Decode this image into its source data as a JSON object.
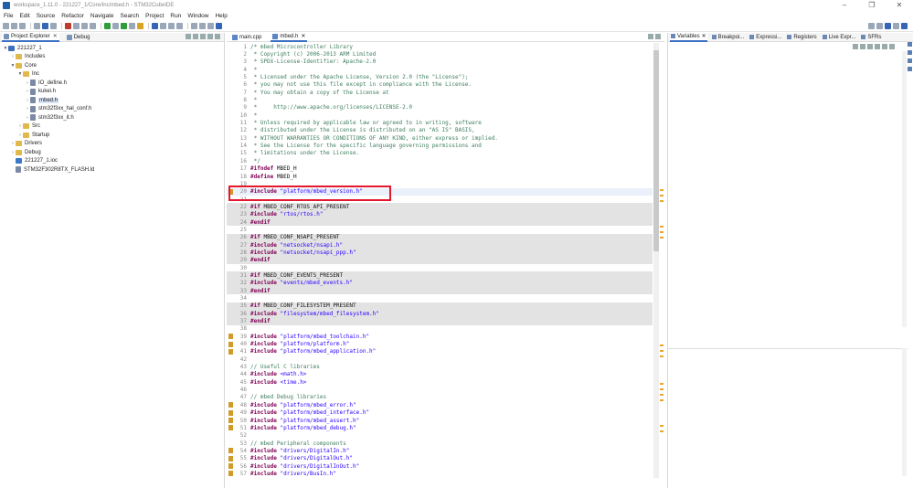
{
  "window": {
    "title": "workspace_1.11.0 - 221227_1/Core/Inc/mbed.h - STM32CubeIDE",
    "controls": [
      "–",
      "❐",
      "✕"
    ]
  },
  "menu": [
    "File",
    "Edit",
    "Source",
    "Refactor",
    "Navigate",
    "Search",
    "Project",
    "Run",
    "Window",
    "Help"
  ],
  "left_panel": {
    "tabs": [
      {
        "label": "Project Explorer",
        "close": "✕"
      },
      {
        "label": "Debug"
      }
    ],
    "tree": [
      {
        "arrow": "▼",
        "label": "221227_1",
        "icon": "proj"
      },
      {
        "arrow": "›",
        "label": "Includes",
        "icon": "fold"
      },
      {
        "arrow": "▼",
        "label": "Core",
        "icon": "fold"
      },
      {
        "arrow": "▼",
        "label": "Inc",
        "icon": "fold"
      },
      {
        "arrow": "›",
        "label": "IO_define.h",
        "icon": "file"
      },
      {
        "arrow": "›",
        "label": "kukei.h",
        "icon": "file"
      },
      {
        "arrow": "›",
        "label": "mbed.h",
        "icon": "file"
      },
      {
        "arrow": "›",
        "label": "stm32f3xx_hal_conf.h",
        "icon": "file"
      },
      {
        "arrow": "›",
        "label": "stm32f3xx_it.h",
        "icon": "file"
      },
      {
        "arrow": "›",
        "label": "Src",
        "icon": "fold"
      },
      {
        "arrow": "›",
        "label": "Startup",
        "icon": "fold"
      },
      {
        "arrow": "›",
        "label": "Drivers",
        "icon": "fold"
      },
      {
        "arrow": "›",
        "label": "Debug",
        "icon": "fold"
      },
      {
        "arrow": "",
        "label": "221227_1.ioc",
        "icon": "ioc"
      },
      {
        "arrow": "",
        "label": "STM32F302R8TX_FLASH.ld",
        "icon": "file"
      }
    ]
  },
  "editor": {
    "tabs": [
      {
        "label": "main.cpp"
      },
      {
        "label": "mbed.h",
        "close": "✕"
      }
    ],
    "lines": [
      {
        "n": "1",
        "t": "/* mbed Microcontroller Library",
        "k": "cm"
      },
      {
        "n": "2",
        "t": " * Copyright (c) 2006-2013 ARM Limited",
        "k": "cm"
      },
      {
        "n": "3",
        "t": " * SPDX-License-Identifier: Apache-2.0",
        "k": "cm"
      },
      {
        "n": "4",
        "t": " *",
        "k": "cm"
      },
      {
        "n": "5",
        "t": " * Licensed under the Apache License, Version 2.0 (the \"License\");",
        "k": "cm"
      },
      {
        "n": "6",
        "t": " * you may not use this file except in compliance with the License.",
        "k": "cm"
      },
      {
        "n": "7",
        "t": " * You may obtain a copy of the License at",
        "k": "cm"
      },
      {
        "n": "8",
        "t": " *",
        "k": "cm"
      },
      {
        "n": "9",
        "t": " *     http://www.apache.org/licenses/LICENSE-2.0",
        "k": "cm"
      },
      {
        "n": "10",
        "t": " *",
        "k": "cm"
      },
      {
        "n": "11",
        "t": " * Unless required by applicable law or agreed to in writing, software",
        "k": "cm"
      },
      {
        "n": "12",
        "t": " * distributed under the License is distributed on an \"AS IS\" BASIS,",
        "k": "cm"
      },
      {
        "n": "13",
        "t": " * WITHOUT WARRANTIES OR CONDITIONS OF ANY KIND, either express or implied.",
        "k": "cm"
      },
      {
        "n": "14",
        "t": " * See the License for the specific language governing permissions and",
        "k": "cm"
      },
      {
        "n": "15",
        "t": " * limitations under the License.",
        "k": "cm"
      },
      {
        "n": "16",
        "t": " */",
        "k": "cm"
      },
      {
        "n": "17",
        "kw": "#ifndef",
        "t": " MBED_H",
        "k": "pp"
      },
      {
        "n": "18",
        "kw": "#define",
        "t": " MBED_H",
        "k": "pp"
      },
      {
        "n": "19",
        "t": "",
        "k": "pl"
      },
      {
        "n": "20",
        "kw": "#include",
        "t": " \"platform/mbed_version.h\"",
        "k": "inc",
        "cur": true,
        "mark": true
      },
      {
        "n": "21",
        "t": "",
        "k": "pl"
      },
      {
        "n": "22",
        "kw": "#if",
        "t": " MBED_CONF_RTOS_API_PRESENT",
        "k": "pp",
        "shade": true
      },
      {
        "n": "23",
        "kw": "#include",
        "t": " \"rtos/rtos.h\"",
        "k": "inc",
        "shade": true
      },
      {
        "n": "24",
        "kw": "#endif",
        "t": "",
        "k": "pp",
        "shade": true
      },
      {
        "n": "25",
        "t": "",
        "k": "pl"
      },
      {
        "n": "26",
        "kw": "#if",
        "t": " MBED_CONF_NSAPI_PRESENT",
        "k": "pp",
        "shade": true
      },
      {
        "n": "27",
        "kw": "#include",
        "t": " \"netsocket/nsapi.h\"",
        "k": "inc",
        "shade": true
      },
      {
        "n": "28",
        "kw": "#include",
        "t": " \"netsocket/nsapi_ppp.h\"",
        "k": "inc",
        "shade": true
      },
      {
        "n": "29",
        "kw": "#endif",
        "t": "",
        "k": "pp",
        "shade": true
      },
      {
        "n": "30",
        "t": "",
        "k": "pl"
      },
      {
        "n": "31",
        "kw": "#if",
        "t": " MBED_CONF_EVENTS_PRESENT",
        "k": "pp",
        "shade": true
      },
      {
        "n": "32",
        "kw": "#include",
        "t": " \"events/mbed_events.h\"",
        "k": "inc",
        "shade": true
      },
      {
        "n": "33",
        "kw": "#endif",
        "t": "",
        "k": "pp",
        "shade": true
      },
      {
        "n": "34",
        "t": "",
        "k": "pl"
      },
      {
        "n": "35",
        "kw": "#if",
        "t": " MBED_CONF_FILESYSTEM_PRESENT",
        "k": "pp",
        "shade": true
      },
      {
        "n": "36",
        "kw": "#include",
        "t": " \"filesystem/mbed_filesystem.h\"",
        "k": "inc",
        "shade": true
      },
      {
        "n": "37",
        "kw": "#endif",
        "t": "",
        "k": "pp",
        "shade": true
      },
      {
        "n": "38",
        "t": "",
        "k": "pl"
      },
      {
        "n": "39",
        "kw": "#include",
        "t": " \"platform/mbed_toolchain.h\"",
        "k": "inc",
        "mark": true
      },
      {
        "n": "40",
        "kw": "#include",
        "t": " \"platform/platform.h\"",
        "k": "inc",
        "mark": true
      },
      {
        "n": "41",
        "kw": "#include",
        "t": " \"platform/mbed_application.h\"",
        "k": "inc",
        "mark": true
      },
      {
        "n": "42",
        "t": "",
        "k": "pl"
      },
      {
        "n": "43",
        "t": "// Useful C libraries",
        "k": "cm"
      },
      {
        "n": "44",
        "kw": "#include",
        "t": " <math.h>",
        "k": "inc"
      },
      {
        "n": "45",
        "kw": "#include",
        "t": " <time.h>",
        "k": "inc"
      },
      {
        "n": "46",
        "t": "",
        "k": "pl"
      },
      {
        "n": "47",
        "t": "// mbed Debug libraries",
        "k": "cm"
      },
      {
        "n": "48",
        "kw": "#include",
        "t": " \"platform/mbed_error.h\"",
        "k": "inc",
        "mark": true
      },
      {
        "n": "49",
        "kw": "#include",
        "t": " \"platform/mbed_interface.h\"",
        "k": "inc",
        "mark": true
      },
      {
        "n": "50",
        "kw": "#include",
        "t": " \"platform/mbed_assert.h\"",
        "k": "inc",
        "mark": true
      },
      {
        "n": "51",
        "kw": "#include",
        "t": " \"platform/mbed_debug.h\"",
        "k": "inc",
        "mark": true
      },
      {
        "n": "52",
        "t": "",
        "k": "pl"
      },
      {
        "n": "53",
        "t": "// mbed Peripheral components",
        "k": "cm"
      },
      {
        "n": "54",
        "kw": "#include",
        "t": " \"drivers/DigitalIn.h\"",
        "k": "inc",
        "mark": true
      },
      {
        "n": "55",
        "kw": "#include",
        "t": " \"drivers/DigitalOut.h\"",
        "k": "inc",
        "mark": true
      },
      {
        "n": "56",
        "kw": "#include",
        "t": " \"drivers/DigitalInOut.h\"",
        "k": "inc",
        "mark": true
      },
      {
        "n": "57",
        "kw": "#include",
        "t": " \"drivers/BusIn.h\"",
        "k": "inc",
        "mark": true
      }
    ]
  },
  "right_panel": {
    "tabs": [
      {
        "label": "Variables",
        "close": "✕"
      },
      {
        "label": "Breakpoi..."
      },
      {
        "label": "Expressi..."
      },
      {
        "label": "Registers"
      },
      {
        "label": "Live Expr..."
      },
      {
        "label": "SFRs"
      }
    ]
  },
  "colors": {
    "highlight_box": "#e3182d",
    "accent": "#3a6fc4"
  }
}
